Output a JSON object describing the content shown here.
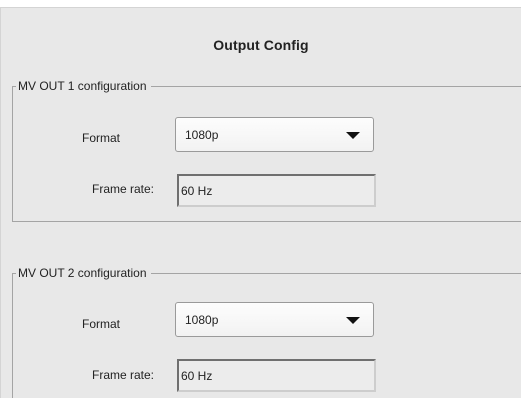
{
  "page": {
    "title": "Output Config"
  },
  "groups": [
    {
      "legend": "MV OUT 1 configuration",
      "format_label": "Format",
      "format_value": "1080p",
      "frame_rate_label": "Frame rate:",
      "frame_rate_value": "60 Hz"
    },
    {
      "legend": "MV OUT 2 configuration",
      "format_label": "Format",
      "format_value": "1080p",
      "frame_rate_label": "Frame rate:",
      "frame_rate_value": "60 Hz"
    }
  ],
  "icons": {
    "dropdown": "chevron-down-icon"
  },
  "colors": {
    "panel_background": "#e8e8e8",
    "group_border": "#a4a4a4",
    "text": "#222222"
  }
}
